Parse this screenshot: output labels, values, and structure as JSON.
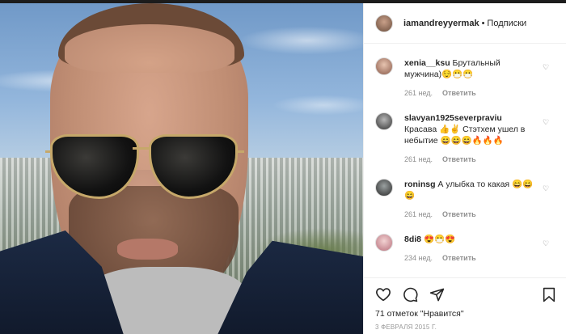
{
  "post": {
    "username": "iamandreyyermak",
    "separator": "•",
    "follow_label": "Подписки"
  },
  "comments": [
    {
      "user": "xenia__ksu",
      "text": "Брутальный мужчина)😌😷😷",
      "time": "261 нед.",
      "reply": "Ответить"
    },
    {
      "user": "slavyan1925severpraviu",
      "text": "Красава 👍✌ Стэтхем ушел в небытие 😄😄😄🔥🔥🔥",
      "time": "261 нед.",
      "reply": "Ответить"
    },
    {
      "user": "roninsg",
      "text": "А улыбка то какая 😄😄😄",
      "time": "261 нед.",
      "reply": "Ответить"
    },
    {
      "user": "8di8",
      "text": "😍😷😍",
      "time": "234 нед.",
      "reply": "Ответить"
    }
  ],
  "footer": {
    "likes": "71 отметок \"Нравится\"",
    "date": "3 ФЕВРАЛЯ 2015 Г."
  },
  "icons": [
    "heart-icon",
    "comment-icon",
    "share-icon",
    "bookmark-icon",
    "like-small-icon"
  ]
}
